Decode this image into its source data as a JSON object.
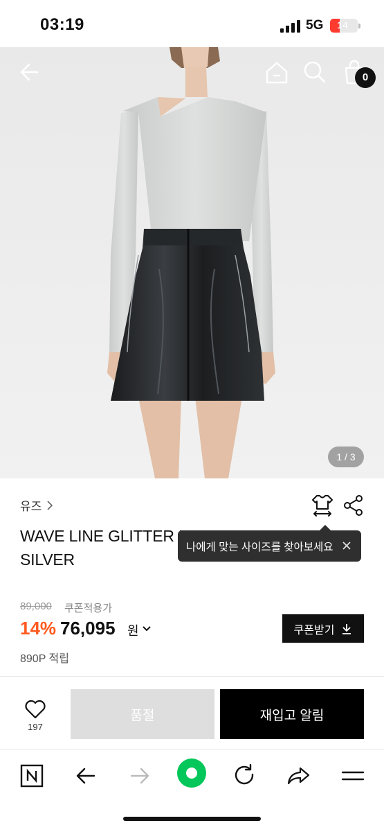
{
  "status_bar": {
    "time": "03:19",
    "network": "5G",
    "battery": "14"
  },
  "hero": {
    "counter": "1 / 3",
    "cart_count": "0"
  },
  "product": {
    "brand": "유즈",
    "title_line1": "WAVE LINE GLITTER METAL KNIT TOP",
    "title_line2": "SILVER",
    "size_tooltip": "나에게 맞는 사이즈를 찾아보세요",
    "original_price": "89,000",
    "coupon_note": "쿠폰적용가",
    "discount": "14%",
    "price": "76,095",
    "currency": "원",
    "coupon_button": "쿠폰받기",
    "points": "890P 적립"
  },
  "purchase_bar": {
    "like_count": "197",
    "soldout_label": "품절",
    "restock_label": "재입고 알림"
  },
  "colors": {
    "accent": "#ff5a1f",
    "dark": "#111111",
    "naver_green": "#03c75a"
  }
}
